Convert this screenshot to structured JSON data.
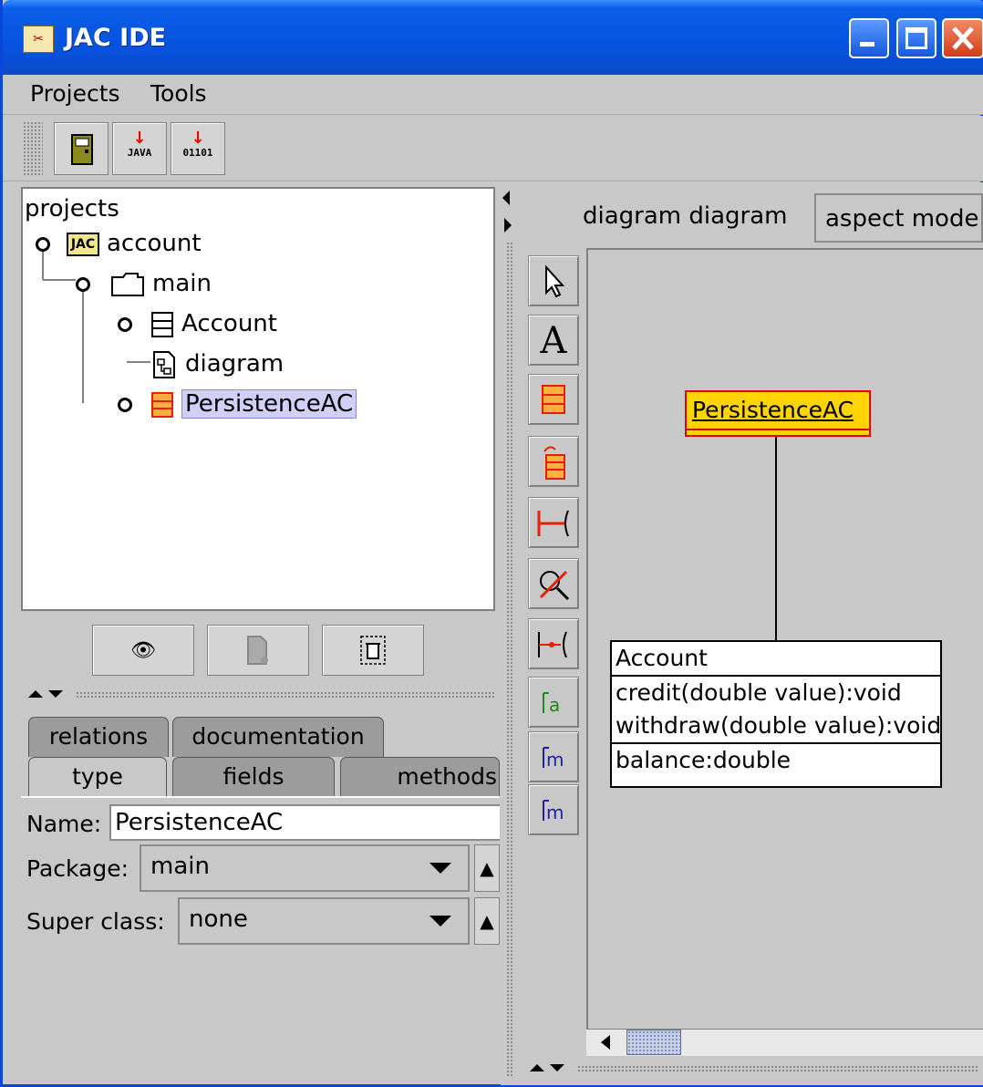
{
  "window": {
    "title": "JAC IDE",
    "app_icon": "jac-app-icon"
  },
  "menu": {
    "items": [
      "Projects",
      "Tools"
    ]
  },
  "toolbar": {
    "btn_gen_java": "JAVA",
    "btn_compile": "01101"
  },
  "tree": {
    "root": "projects",
    "project": "account",
    "package": "main",
    "items": [
      "Account",
      "diagram",
      "PersistenceAC"
    ]
  },
  "tabs": {
    "row1": [
      "relations",
      "documentation"
    ],
    "row2": [
      "type",
      "fields",
      "methods"
    ],
    "active": "type"
  },
  "form": {
    "name_label": "Name:",
    "name_value": "PersistenceAC",
    "package_label": "Package:",
    "package_value": "main",
    "super_label": "Super class:",
    "super_value": "none"
  },
  "diagram": {
    "label": "diagram diagram",
    "mode": "aspect mode",
    "aspect_box": "PersistenceAC",
    "class_name": "Account",
    "methods": [
      "credit(double value):void",
      "withdraw(double value):void"
    ],
    "fields": [
      "balance:double"
    ]
  },
  "colors": {
    "titlebar": "#0753e0",
    "aspect_fill": "#ffd400",
    "aspect_border": "#e00000",
    "accent_red": "#e82000"
  }
}
